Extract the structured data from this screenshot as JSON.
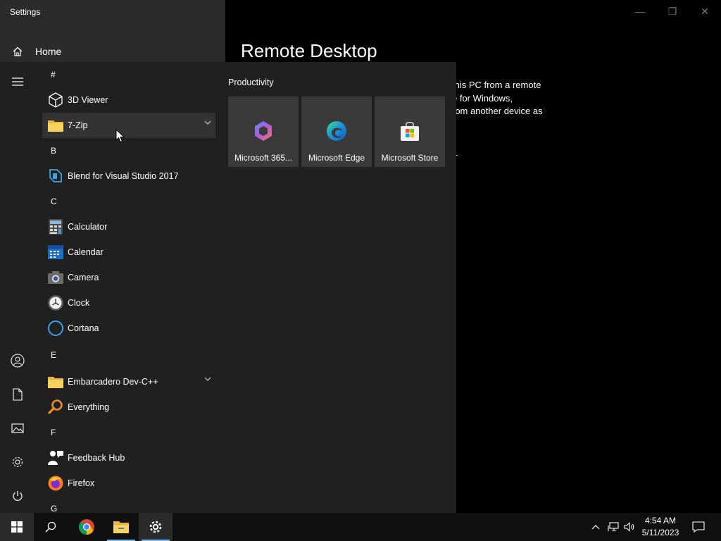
{
  "settings": {
    "window_title": "Settings",
    "home_label": "Home",
    "page_title": "Remote Desktop",
    "description_lines": [
      "this PC from a remote",
      "e for Windows,",
      "rom another device as"
    ],
    "stray_text": "-"
  },
  "start_menu": {
    "app_list": [
      {
        "type": "group",
        "label": "#"
      },
      {
        "type": "app",
        "label": "3D Viewer",
        "icon": "cube-icon"
      },
      {
        "type": "app",
        "label": "7-Zip",
        "icon": "folder-icon",
        "expandable": true,
        "highlighted": true
      },
      {
        "type": "group",
        "label": "B"
      },
      {
        "type": "app",
        "label": "Blend for Visual Studio 2017",
        "icon": "blend-icon"
      },
      {
        "type": "group",
        "label": "C"
      },
      {
        "type": "app",
        "label": "Calculator",
        "icon": "calculator-icon"
      },
      {
        "type": "app",
        "label": "Calendar",
        "icon": "calendar-icon"
      },
      {
        "type": "app",
        "label": "Camera",
        "icon": "camera-icon"
      },
      {
        "type": "app",
        "label": "Clock",
        "icon": "clock-icon"
      },
      {
        "type": "app",
        "label": "Cortana",
        "icon": "cortana-icon"
      },
      {
        "type": "group",
        "label": "E"
      },
      {
        "type": "app",
        "label": "Embarcadero Dev-C++",
        "icon": "folder-icon",
        "expandable": true
      },
      {
        "type": "app",
        "label": "Everything",
        "icon": "search-magnifier-icon"
      },
      {
        "type": "group",
        "label": "F"
      },
      {
        "type": "app",
        "label": "Feedback Hub",
        "icon": "feedback-hub-icon"
      },
      {
        "type": "app",
        "label": "Firefox",
        "icon": "firefox-icon"
      },
      {
        "type": "group",
        "label": "G"
      }
    ],
    "tiles_group_title": "Productivity",
    "tiles": [
      {
        "label": "Microsoft 365...",
        "icon": "microsoft-365-icon"
      },
      {
        "label": "Microsoft Edge",
        "icon": "edge-icon"
      },
      {
        "label": "Microsoft Store",
        "icon": "store-icon"
      }
    ]
  },
  "taskbar": {
    "time": "4:54 AM",
    "date": "5/11/2023"
  },
  "colors": {
    "start_bg": "#202020",
    "tile_bg": "#3a3a3a",
    "taskbar_bg": "#101010",
    "accent": "#76b9ed"
  }
}
